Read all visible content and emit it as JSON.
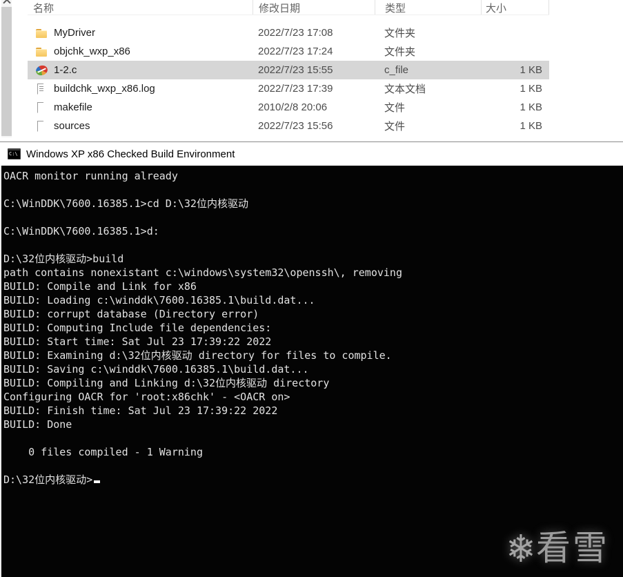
{
  "explorer": {
    "columns": {
      "name": "名称",
      "date": "修改日期",
      "type": "类型",
      "size": "大小"
    },
    "files": [
      {
        "name": "MyDriver",
        "date": "2022/7/23 17:08",
        "type": "文件夹",
        "size": "",
        "icon": "folder-icon"
      },
      {
        "name": "objchk_wxp_x86",
        "date": "2022/7/23 17:24",
        "type": "文件夹",
        "size": "",
        "icon": "folder-icon"
      },
      {
        "name": "1-2.c",
        "date": "2022/7/23 15:55",
        "type": "c_file",
        "size": "1 KB",
        "icon": "c-source-icon",
        "selected": true
      },
      {
        "name": "buildchk_wxp_x86.log",
        "date": "2022/7/23 17:39",
        "type": "文本文档",
        "size": "1 KB",
        "icon": "text-document-icon"
      },
      {
        "name": "makefile",
        "date": "2010/2/8 20:06",
        "type": "文件",
        "size": "1 KB",
        "icon": "generic-file-icon"
      },
      {
        "name": "sources",
        "date": "2022/7/23 15:56",
        "type": "文件",
        "size": "1 KB",
        "icon": "generic-file-icon"
      }
    ]
  },
  "terminal": {
    "title": "Windows XP x86 Checked Build Environment",
    "title_icon": "cmd-icon",
    "lines": [
      "OACR monitor running already",
      "",
      "C:\\WinDDK\\7600.16385.1>cd D:\\32位内核驱动",
      "",
      "C:\\WinDDK\\7600.16385.1>d:",
      "",
      "D:\\32位内核驱动>build",
      "path contains nonexistant c:\\windows\\system32\\openssh\\, removing",
      "BUILD: Compile and Link for x86",
      "BUILD: Loading c:\\winddk\\7600.16385.1\\build.dat...",
      "BUILD: corrupt database (Directory error)",
      "BUILD: Computing Include file dependencies:",
      "BUILD: Start time: Sat Jul 23 17:39:22 2022",
      "BUILD: Examining d:\\32位内核驱动 directory for files to compile.",
      "BUILD: Saving c:\\winddk\\7600.16385.1\\build.dat...",
      "BUILD: Compiling and Linking d:\\32位内核驱动 directory",
      "Configuring OACR for 'root:x86chk' - <OACR on>",
      "BUILD: Finish time: Sat Jul 23 17:39:22 2022",
      "BUILD: Done",
      "",
      "    0 files compiled - 1 Warning",
      ""
    ],
    "prompt": "D:\\32位内核驱动>",
    "watermark": {
      "icon": "snowflake-icon",
      "glyph": "❄",
      "text": "看雪"
    }
  },
  "colors": {
    "selection_bg": "#d6d6d6",
    "terminal_bg": "#040404",
    "terminal_fg": "#e2e2e2",
    "folder_yellow": "#f5c65e",
    "watermark_gray": "#9c9c9c"
  }
}
